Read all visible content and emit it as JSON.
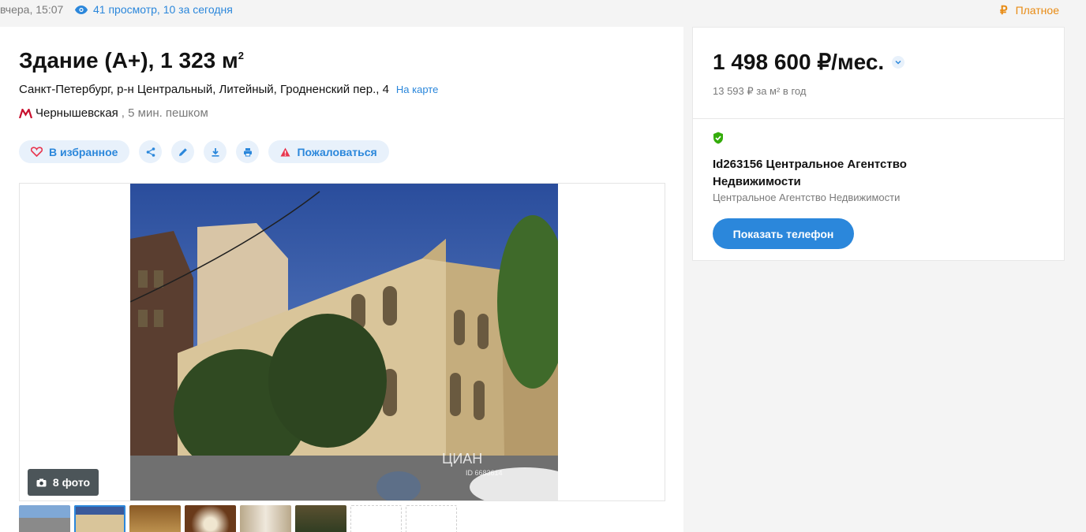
{
  "header": {
    "date": "вчера, 15:07",
    "views": "41 просмотр, 10 за сегодня",
    "paid_symbol": "₽",
    "paid_label": "Платное"
  },
  "listing": {
    "title": "Здание (А+), 1 323 м",
    "title_sup": "2",
    "address": "Санкт-Петербург, р-н Центральный, Литейный, Гродненский пер., 4",
    "map_link": "На карте",
    "metro_station": "Чернышевская",
    "metro_walk": ", 5 мин. пешком",
    "metro_color": "#c8102e"
  },
  "actions": {
    "favorite": "В избранное",
    "complain": "Пожаловаться"
  },
  "gallery": {
    "photo_count": "8 фото",
    "watermark": "ЦИАН",
    "watermark_id": "ID 6683614"
  },
  "sidebar": {
    "price": "1 498 600 ₽/мес.",
    "price_per": "13 593 ₽ за м² в год",
    "agent_name": "Id263156 Центральное Агентство Недвижимости",
    "agent_sub": "Центральное Агентство Недвижимости",
    "phone_button": "Показать телефон"
  },
  "colors": {
    "accent": "#2b87db",
    "paid": "#e88b14",
    "verified": "#34ac0a"
  },
  "icons": [
    "eye-icon",
    "ruble-icon",
    "metro-icon",
    "heart-icon",
    "share-icon",
    "pencil-icon",
    "download-icon",
    "print-icon",
    "warning-icon",
    "camera-icon",
    "chevron-down-icon",
    "shield-check-icon"
  ]
}
